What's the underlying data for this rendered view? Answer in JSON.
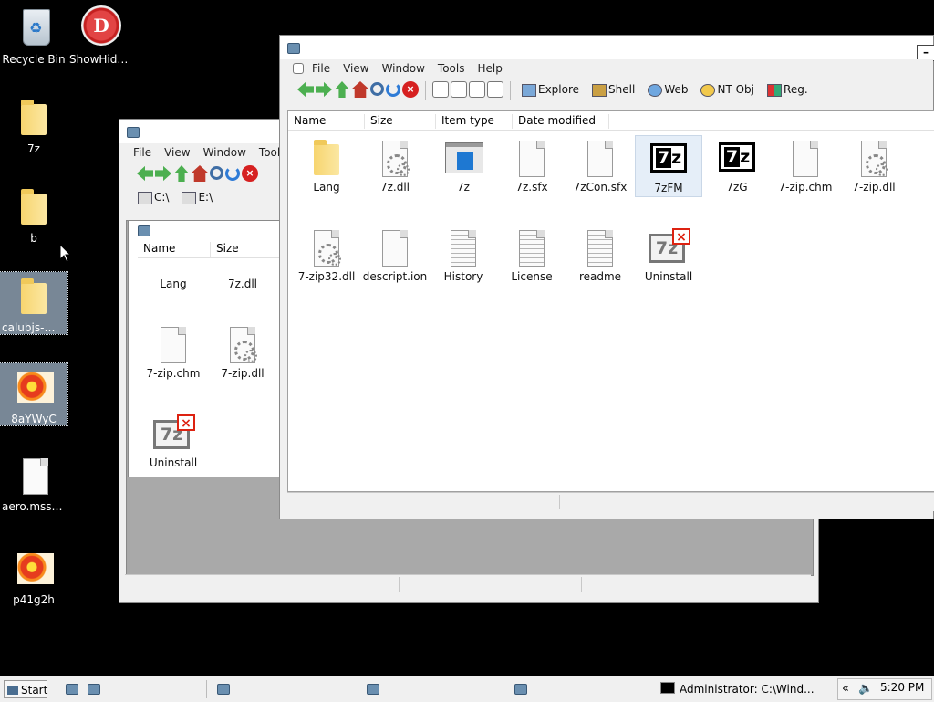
{
  "desktop": {
    "icons": [
      {
        "label": "Recycle Bin",
        "icon": "recycle-bin-icon"
      },
      {
        "label": "ShowHide...",
        "icon": "showhide-icon"
      },
      {
        "label": "7z",
        "icon": "folder-icon"
      },
      {
        "label": "b",
        "icon": "folder-icon"
      },
      {
        "label": "calubjs-main",
        "icon": "folder-icon"
      },
      {
        "label": "8aYWyC",
        "icon": "image-icon"
      },
      {
        "label": "aero.msstyles",
        "icon": "file-icon"
      },
      {
        "label": "p41g2h",
        "icon": "image-icon"
      }
    ]
  },
  "back_window": {
    "menu": [
      "File",
      "View",
      "Window",
      "Tools"
    ],
    "drives": [
      "C:\\",
      "E:\\"
    ],
    "columns": [
      "Name",
      "Size"
    ],
    "items": [
      {
        "name": "Lang",
        "icon": "folder-icon"
      },
      {
        "name": "7z.dll",
        "icon": "dll-icon"
      },
      {
        "name": "7-zip.chm",
        "icon": "file-icon"
      },
      {
        "name": "7-zip.dll",
        "icon": "dll-icon"
      },
      {
        "name": "Uninstall",
        "icon": "uninstall-icon"
      }
    ]
  },
  "front_window": {
    "menu": [
      "File",
      "View",
      "Window",
      "Tools",
      "Help"
    ],
    "toolbar_labels": [
      "Explore",
      "Shell",
      "Web",
      "NT Obj",
      "Reg."
    ],
    "columns": [
      "Name",
      "Size",
      "Item type",
      "Date modified"
    ],
    "minimize_label": "–",
    "items": [
      {
        "name": "Lang",
        "icon": "folder-icon"
      },
      {
        "name": "7z.dll",
        "icon": "dll-icon"
      },
      {
        "name": "7z",
        "icon": "exe-icon"
      },
      {
        "name": "7z.sfx",
        "icon": "file-icon"
      },
      {
        "name": "7zCon.sfx",
        "icon": "file-icon"
      },
      {
        "name": "7zFM",
        "icon": "7z-icon"
      },
      {
        "name": "7zG",
        "icon": "7z-icon"
      },
      {
        "name": "7-zip.chm",
        "icon": "file-icon"
      },
      {
        "name": "7-zip.dll",
        "icon": "dll-icon"
      },
      {
        "name": "7-zip32.dll",
        "icon": "dll-icon"
      },
      {
        "name": "descript.ion",
        "icon": "file-icon"
      },
      {
        "name": "History",
        "icon": "text-file-icon"
      },
      {
        "name": "License",
        "icon": "text-file-icon"
      },
      {
        "name": "readme",
        "icon": "text-file-icon"
      },
      {
        "name": "Uninstall",
        "icon": "uninstall-icon"
      }
    ]
  },
  "taskbar": {
    "start_label": "Start",
    "console_label": "Administrator: C:\\Wind...",
    "tray_chevron": "«",
    "clock": "5:20 PM"
  }
}
